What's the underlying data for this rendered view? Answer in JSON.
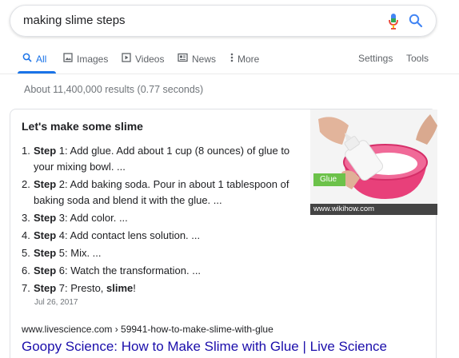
{
  "search": {
    "query": "making slime steps"
  },
  "tabs": {
    "items": [
      {
        "label": "All",
        "icon": "search-icon"
      },
      {
        "label": "Images",
        "icon": "image-icon"
      },
      {
        "label": "Videos",
        "icon": "play-icon"
      },
      {
        "label": "News",
        "icon": "news-icon"
      },
      {
        "label": "More",
        "icon": "more-vert-icon"
      }
    ],
    "settings_label": "Settings",
    "tools_label": "Tools"
  },
  "result_stats": "About 11,400,000 results (0.77 seconds)",
  "snippet": {
    "heading": "Let's make some slime",
    "steps": [
      {
        "num": "1.",
        "bold": "Step",
        "text": " 1: Add glue. Add about 1 cup (8 ounces) of glue to your mixing bowl. ..."
      },
      {
        "num": "2.",
        "bold": "Step",
        "text": " 2: Add baking soda. Pour in about 1 tablespoon of baking soda and blend it with the glue. ..."
      },
      {
        "num": "3.",
        "bold": "Step",
        "text": " 3: Add color. ..."
      },
      {
        "num": "4.",
        "bold": "Step",
        "text": " 4: Add contact lens solution. ..."
      },
      {
        "num": "5.",
        "bold": "Step",
        "text": " 5: Mix. ..."
      },
      {
        "num": "6.",
        "bold": "Step",
        "text": " 6: Watch the transformation. ..."
      },
      {
        "num": "7.",
        "bold": "Step",
        "text": " 7: Presto, ",
        "bold2": "slime",
        "tail": "!"
      }
    ],
    "date": "Jul 26, 2017",
    "image_label": "Glue",
    "image_caption": "www.wikihow.com",
    "source_url": "www.livescience.com › 59941-how-to-make-slime-with-glue",
    "title": "Goopy Science: How to Make Slime with Glue | Live Science"
  },
  "colors": {
    "accent": "#1a73e8",
    "link": "#1a0dab",
    "bowl": "#e8407a",
    "glue_label": "#6cc24a"
  }
}
